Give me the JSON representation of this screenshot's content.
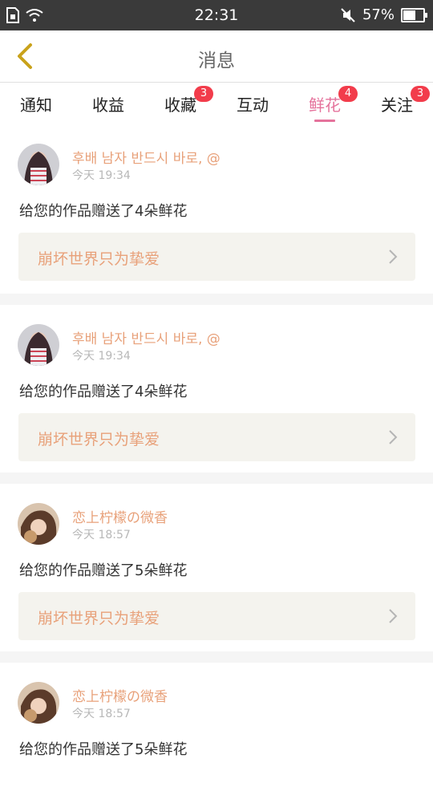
{
  "status_bar": {
    "time": "22:31",
    "battery": "57%",
    "battery_level": 0.57
  },
  "header": {
    "title": "消息"
  },
  "tabs": [
    {
      "label": "通知",
      "badge": ""
    },
    {
      "label": "收益",
      "badge": ""
    },
    {
      "label": "收藏",
      "badge": "3"
    },
    {
      "label": "互动",
      "badge": ""
    },
    {
      "label": "鲜花",
      "badge": "4",
      "active": true
    },
    {
      "label": "关注",
      "badge": "3"
    }
  ],
  "items": [
    {
      "name": "후배 남자 반드시 바로, @",
      "time": "今天 19:34",
      "message": "给您的作品赠送了4朵鲜花",
      "work": "崩坏世界只为挚爱"
    },
    {
      "name": "후배 남자 반드시 바로, @",
      "time": "今天 19:34",
      "message": "给您的作品赠送了4朵鲜花",
      "work": "崩坏世界只为挚爱"
    },
    {
      "name": "恋上柠檬の微香",
      "time": "今天 18:57",
      "message": "给您的作品赠送了5朵鲜花",
      "work": "崩坏世界只为挚爱"
    },
    {
      "name": "恋上柠檬の微香",
      "time": "今天 18:57",
      "message": "给您的作品赠送了5朵鲜花",
      "work": ""
    }
  ],
  "icons": {
    "back": "chevron-left-icon",
    "chevron": "chevron-right-icon",
    "sim": "sim-card-icon",
    "wifi": "wifi-icon",
    "mute": "mute-icon",
    "battery": "battery-icon"
  },
  "colors": {
    "accent": "#e5739c",
    "name": "#e8a17a",
    "badge": "#f23c4b",
    "back": "#c9a21b"
  }
}
